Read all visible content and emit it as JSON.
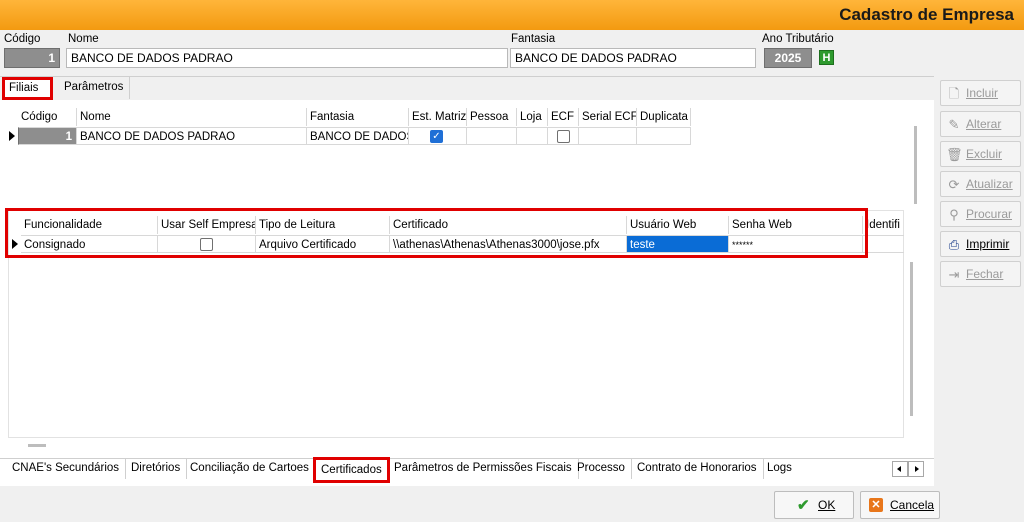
{
  "window": {
    "title": "Cadastro de Empresa"
  },
  "header": {
    "codigo_label": "Código",
    "codigo_value": "1",
    "nome_label": "Nome",
    "nome_value": "BANCO DE DADOS PADRAO",
    "fantasia_label": "Fantasia",
    "fantasia_value": "BANCO DE DADOS PADRAO",
    "ano_label": "Ano Tributário",
    "ano_value": "2025",
    "ano_button": "H"
  },
  "top_tabs": [
    {
      "label": "Filiais",
      "active": true
    },
    {
      "label": "Parâmetros",
      "active": false
    }
  ],
  "filiais_grid": {
    "columns": [
      "Código",
      "Nome",
      "Fantasia",
      "Est. Matriz",
      "Pessoa",
      "Loja",
      "ECF",
      "Serial ECF",
      "Duplicata"
    ],
    "rows": [
      {
        "codigo": "1",
        "nome": "BANCO DE DADOS PADRAO",
        "fantasia": "BANCO DE DADOS",
        "est_matriz": true,
        "pessoa": "",
        "loja": "",
        "ecf": false,
        "serial_ecf": "",
        "duplicata": ""
      }
    ]
  },
  "cert_grid": {
    "columns": [
      "Funcionalidade",
      "Usar Self Empresa",
      "Tipo de Leitura",
      "Certificado",
      "Usuário Web",
      "Senha Web",
      "Identifi"
    ],
    "rows": [
      {
        "funcionalidade": "Consignado",
        "usar_self_empresa": false,
        "tipo_leitura": "Arquivo Certificado",
        "certificado": "\\\\athenas\\Athenas\\Athenas3000\\jose.pfx",
        "usuario_web": "teste",
        "senha_web": "******"
      }
    ]
  },
  "side_buttons": [
    {
      "label": "Incluir",
      "icon": "page-icon",
      "glyph": "🗋",
      "enabled": false
    },
    {
      "label": "Alterar",
      "icon": "edit-icon",
      "glyph": "✎",
      "enabled": false
    },
    {
      "label": "Excluir",
      "icon": "trash-icon",
      "glyph": "🗑",
      "enabled": false
    },
    {
      "label": "Atualizar",
      "icon": "refresh-icon",
      "glyph": "⟳",
      "enabled": false
    },
    {
      "label": "Procurar",
      "icon": "binoculars-icon",
      "glyph": "⚲",
      "enabled": false
    },
    {
      "label": "Imprimir",
      "icon": "printer-icon",
      "glyph": "⎙",
      "enabled": true
    },
    {
      "label": "Fechar",
      "icon": "close-door-icon",
      "glyph": "⇥",
      "enabled": false
    }
  ],
  "bottom_tabs": [
    {
      "label": "CNAE's Secundários",
      "active": false
    },
    {
      "label": "Diretórios",
      "active": false
    },
    {
      "label": "Conciliação de Cartoes",
      "active": false
    },
    {
      "label": "Certificados",
      "active": true
    },
    {
      "label": "Parâmetros de Permissões Fiscais",
      "active": false
    },
    {
      "label": "Processo",
      "active": false
    },
    {
      "label": "Contrato de Honorarios",
      "active": false
    },
    {
      "label": "Logs",
      "active": false
    }
  ],
  "dialog": {
    "ok_label": "OK",
    "cancel_label": "Cancela"
  },
  "colors": {
    "title_gradient_top": "#ffb53a",
    "title_gradient_bottom": "#f39a10",
    "highlight_red": "#e00000",
    "selection_blue": "#0a6cd6",
    "ok_green": "#2e9a2e",
    "cancel_orange": "#e8761a"
  }
}
